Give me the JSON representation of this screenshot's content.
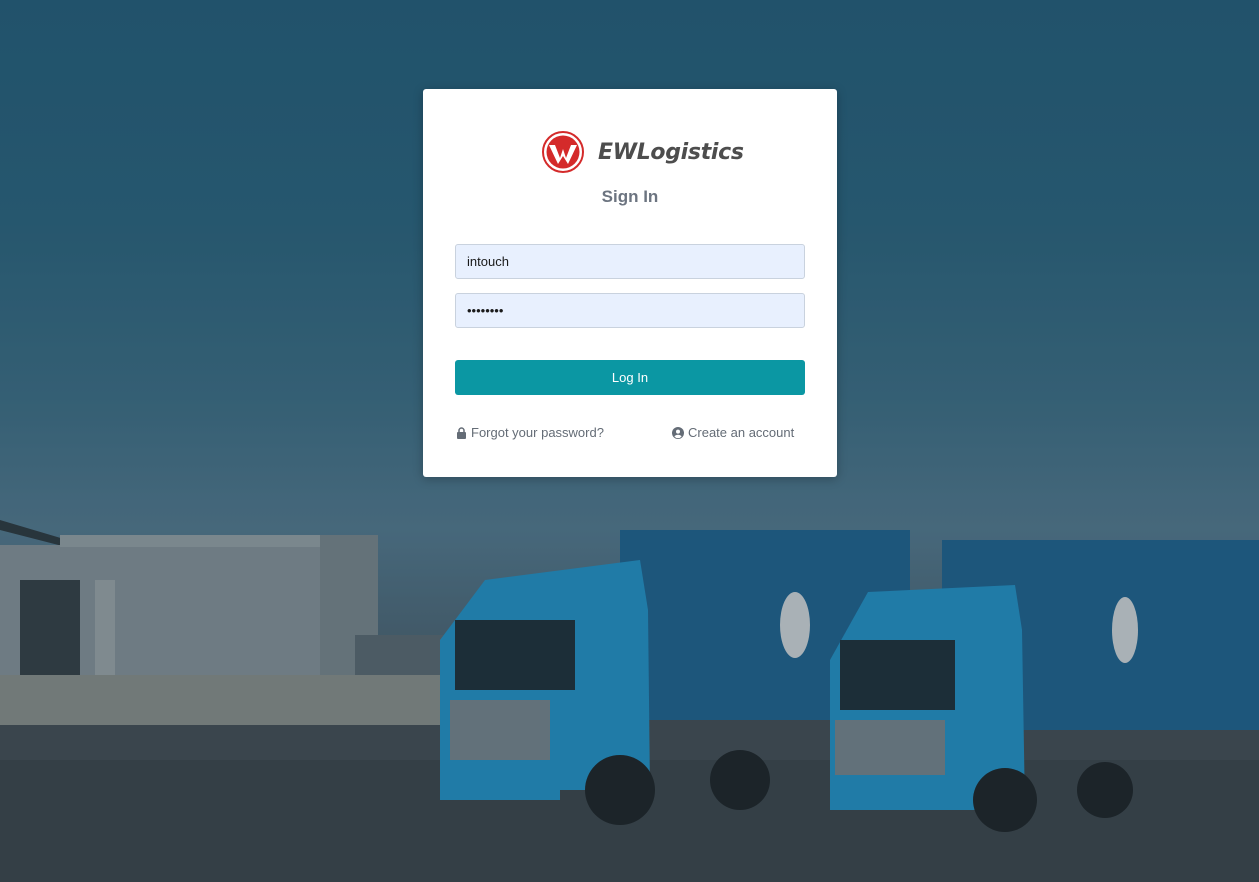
{
  "brand": {
    "name": "EWLogistics",
    "logo_letter": "W",
    "logo_color": "#d42a2a"
  },
  "form": {
    "title": "Sign In",
    "username_value": "intouch",
    "password_value": "••••••••",
    "login_button": "Log In"
  },
  "links": {
    "forgot_password": "Forgot your password?",
    "forgot_icon": "lock-icon",
    "create_account": "Create an account",
    "create_icon": "user-circle-icon"
  },
  "colors": {
    "accent": "#0b97a3",
    "input_bg": "#e8f0fe",
    "text_muted": "#646c76"
  }
}
